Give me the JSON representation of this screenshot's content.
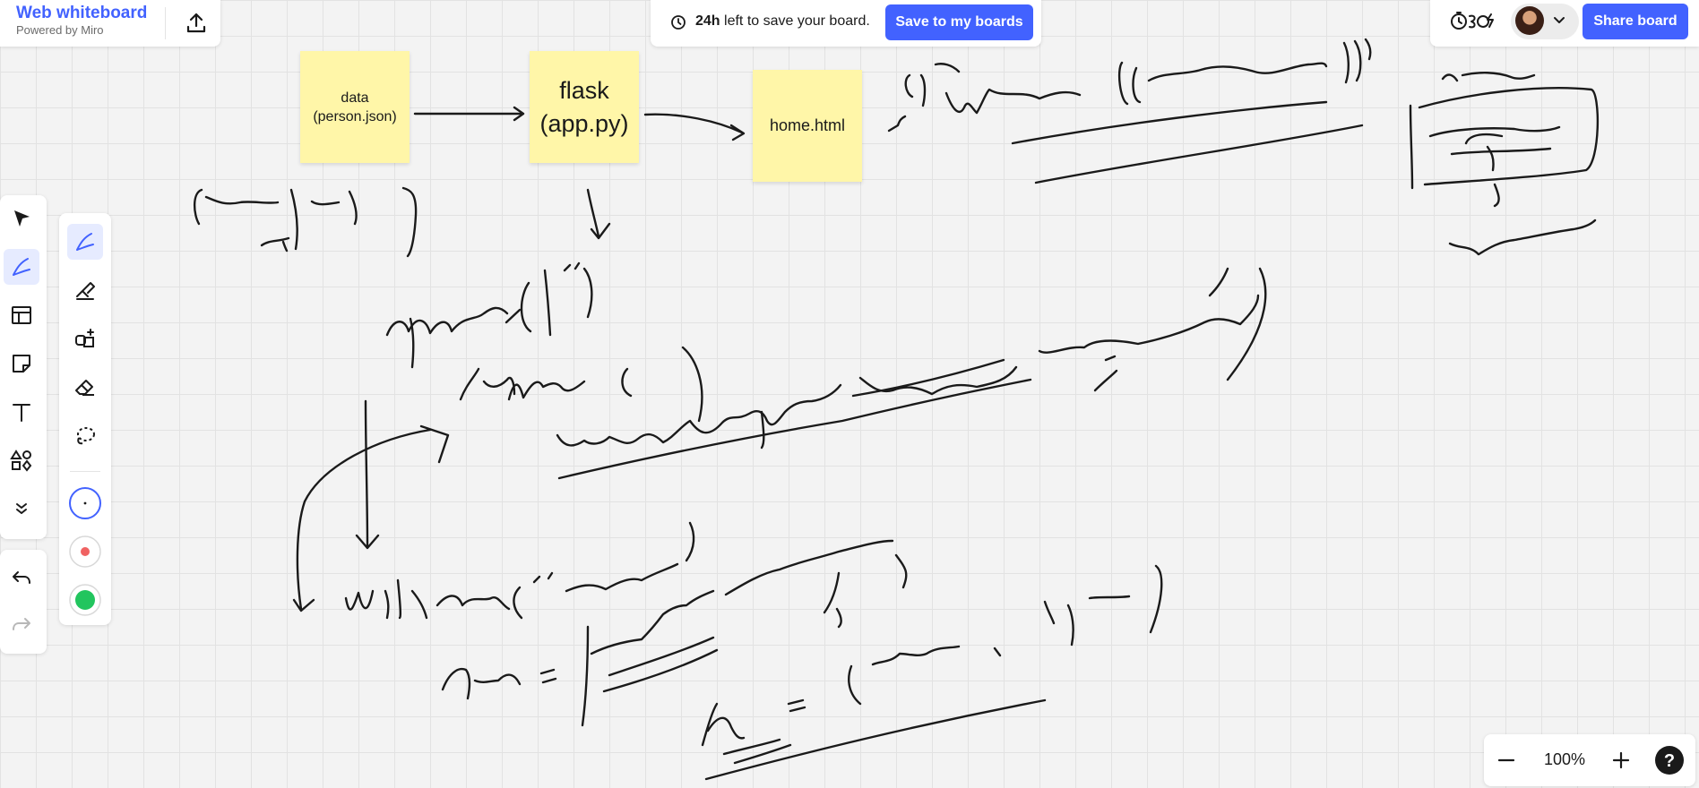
{
  "app": {
    "title": "Web whiteboard",
    "subtitle": "Powered by Miro"
  },
  "notice": {
    "hours": "24h",
    "message": " left to save your board."
  },
  "buttons": {
    "save": "Save to my boards",
    "share": "Share board"
  },
  "zoom": {
    "value": "100%"
  },
  "stickies": [
    {
      "line1": "data",
      "line2": "(person.json)"
    },
    {
      "line1": "flask",
      "line2": "(app.py)"
    },
    {
      "line1": "home.html"
    }
  ],
  "colors": {
    "accent": "#4262ff",
    "sticky": "#fff6a8",
    "ink": "#1a1a1a",
    "red_swatch": "#f06262",
    "green_swatch": "#22c55e"
  },
  "icons": [
    "upload-icon",
    "clock-icon",
    "timer-icon",
    "chevron-down-icon",
    "select-icon",
    "pen-icon",
    "template-icon",
    "sticky-note-icon",
    "text-icon",
    "shapes-icon",
    "more-icon",
    "undo-icon",
    "redo-icon",
    "highlighter-icon",
    "smart-draw-icon",
    "eraser-icon",
    "lasso-icon",
    "minus-icon",
    "plus-icon",
    "help-icon"
  ]
}
